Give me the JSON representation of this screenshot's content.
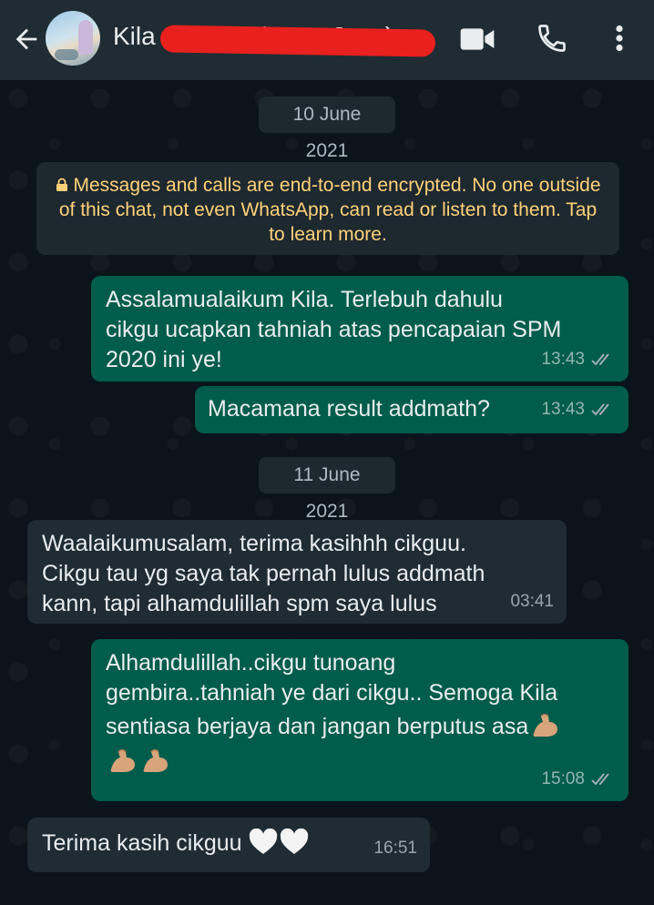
{
  "header": {
    "contact_name": "Kila Student (Paya Jaya)",
    "back_icon": "back-arrow-icon",
    "video_icon": "video-call-icon",
    "call_icon": "phone-icon",
    "menu_icon": "more-vert-icon"
  },
  "chat": {
    "date_1": "10 June 2021",
    "encryption_notice": "Messages and calls are end-to-end encrypted. No one outside of this chat, not even WhatsApp, can read or listen to them. Tap to learn more.",
    "date_2": "11 June 2021",
    "messages": [
      {
        "direction": "out",
        "text": "Assalamualaikum Kila. Terlebuh dahulu\ncikgu ucapkan tahniah atas pencapaian SPM\n2020 ini ye!",
        "time": "13:43",
        "status": "read"
      },
      {
        "direction": "out",
        "text": "Macamana result addmath?",
        "time": "13:43",
        "status": "read"
      },
      {
        "direction": "in",
        "text": "Waalaikumusalam, terima kasihhh cikguu.\nCikgu tau yg saya tak pernah lulus addmath\nkann, tapi alhamdulillah spm saya lulus",
        "time": "03:41"
      },
      {
        "direction": "out",
        "text": "Alhamdulillah..cikgu tunoang\ngembira..tahniah ye dari cikgu.. Semoga Kila\nsentiasa berjaya dan jangan berputus asa",
        "emoji_line": "💪💪",
        "time": "15:08",
        "status": "read"
      },
      {
        "direction": "in",
        "text": "Terima kasih cikguu",
        "time": "16:51"
      }
    ]
  },
  "colors": {
    "header_bg": "#1f2c33",
    "chat_bg": "#0b141a",
    "outgoing_bubble": "#005c4b",
    "incoming_bubble": "#1f2c34",
    "encryption_text": "#ffd279",
    "read_ticks": "#a8b4ba"
  }
}
